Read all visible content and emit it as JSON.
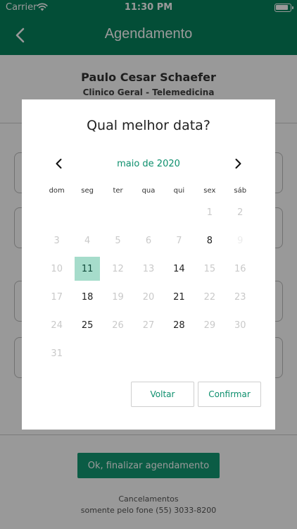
{
  "status_bar": {
    "carrier": "Carrier",
    "time": "11:30 PM",
    "wifi_icon": "wifi-icon",
    "battery_icon": "battery-icon"
  },
  "nav": {
    "title": "Agendamento",
    "back_icon": "chevron-left-icon"
  },
  "doctor": {
    "name": "Paulo Cesar Schaefer",
    "specialty": "Clinico Geral - Telemedicina"
  },
  "actions": {
    "finish_label": "Ok, finalizar agendamento"
  },
  "footer": {
    "line1": "Cancelamentos",
    "line2": "somente pelo fone (55) 3033-8200"
  },
  "modal": {
    "title": "Qual melhor data?",
    "month_label": "maio de 2020",
    "weekdays": [
      "dom",
      "seg",
      "ter",
      "qua",
      "qui",
      "sex",
      "sáb"
    ],
    "weeks": [
      [
        null,
        null,
        null,
        null,
        null,
        "1",
        "2"
      ],
      [
        "3",
        "4",
        "5",
        "6",
        "7",
        "8",
        "9"
      ],
      [
        "10",
        "11",
        "12",
        "13",
        "14",
        "15",
        "16"
      ],
      [
        "17",
        "18",
        "19",
        "20",
        "21",
        "22",
        "23"
      ],
      [
        "24",
        "25",
        "26",
        "27",
        "28",
        "29",
        "30"
      ],
      [
        "31",
        null,
        null,
        null,
        null,
        null,
        null
      ]
    ],
    "enabled_days": [
      "8",
      "11",
      "14",
      "18",
      "21",
      "25",
      "28"
    ],
    "faint_days": [
      "9"
    ],
    "selected_day": "11",
    "back_label": "Voltar",
    "confirm_label": "Confirmar"
  },
  "colors": {
    "primary": "#06825d",
    "accent": "#0d8f6d",
    "selected_bg": "#a6dccb"
  }
}
